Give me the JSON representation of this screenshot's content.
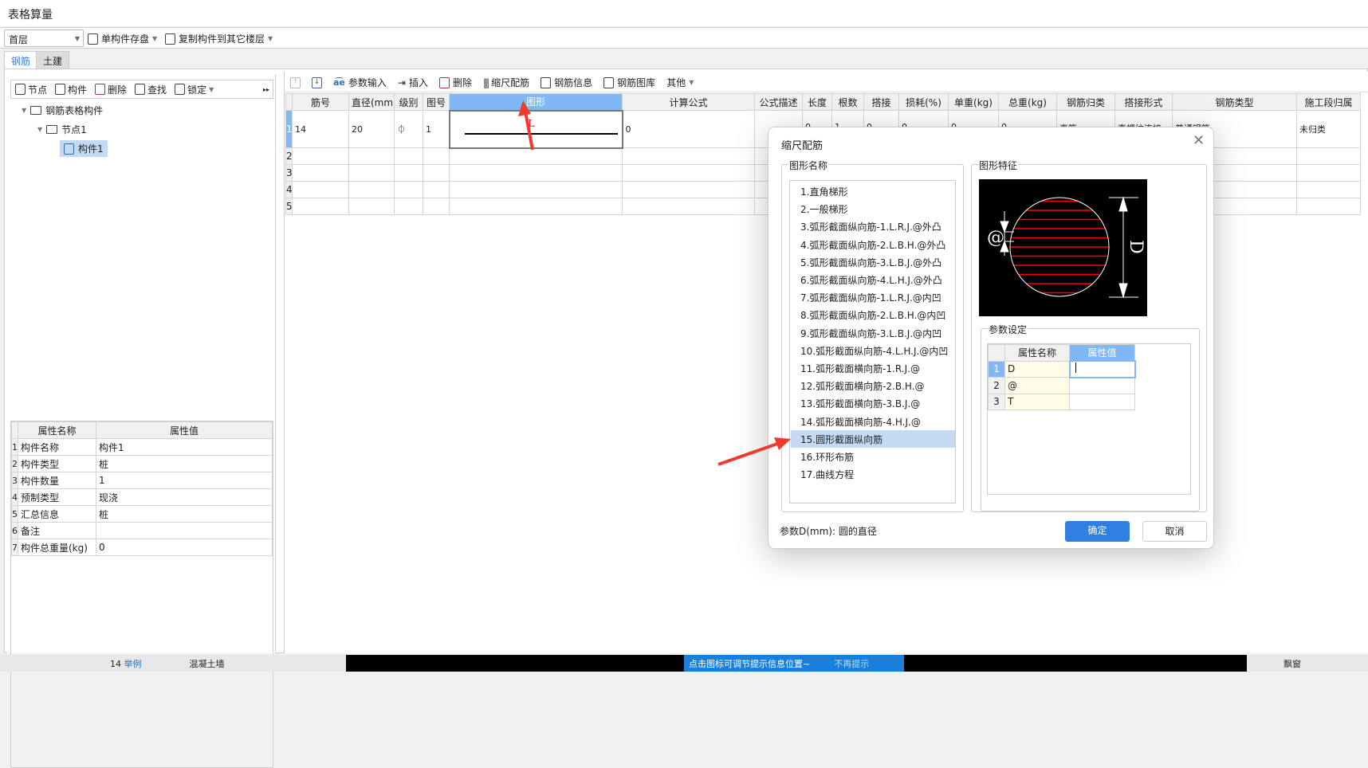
{
  "window": {
    "title": "表格算量"
  },
  "toolbar": {
    "floor": "首层",
    "save_single": "单构件存盘",
    "copy_to_floors": "复制构件到其它楼层"
  },
  "tabs": [
    {
      "label": "钢筋",
      "active": true
    },
    {
      "label": "土建",
      "active": false
    }
  ],
  "left_toolbar": {
    "node": "节点",
    "component": "构件",
    "delete": "删除",
    "find": "查找",
    "lock": "锁定"
  },
  "tree": {
    "root": "钢筋表格构件",
    "node": "节点1",
    "component": "构件1"
  },
  "props": {
    "headers": [
      "属性名称",
      "属性值"
    ],
    "rows": [
      {
        "n": "1",
        "name": "构件名称",
        "value": "构件1"
      },
      {
        "n": "2",
        "name": "构件类型",
        "value": "桩"
      },
      {
        "n": "3",
        "name": "构件数量",
        "value": "1"
      },
      {
        "n": "4",
        "name": "预制类型",
        "value": "现浇"
      },
      {
        "n": "5",
        "name": "汇总信息",
        "value": "桩"
      },
      {
        "n": "6",
        "name": "备注",
        "value": ""
      },
      {
        "n": "7",
        "name": "构件总重量(kg)",
        "value": "0"
      }
    ]
  },
  "right_toolbar": {
    "param_input": "参数输入",
    "insert": "插入",
    "delete": "删除",
    "scale_rebar": "缩尺配筋",
    "rebar_info": "钢筋信息",
    "rebar_library": "钢筋图库",
    "other": "其他"
  },
  "grid": {
    "headers": [
      "筋号",
      "直径(mm)",
      "级别",
      "图号",
      "图形",
      "计算公式",
      "公式描述",
      "长度",
      "根数",
      "搭接",
      "损耗(%)",
      "单重(kg)",
      "总重(kg)",
      "钢筋归类",
      "搭接形式",
      "钢筋类型",
      "施工段归属"
    ],
    "rows": [
      {
        "n": "1",
        "cells": [
          "14",
          "20",
          "⏀",
          "1",
          "L",
          "0",
          "",
          "0",
          "1",
          "0",
          "0",
          "0",
          "0",
          "直筋",
          "直螺纹连接",
          "普通钢筋",
          "未归类"
        ]
      },
      {
        "n": "2",
        "cells": [
          "",
          "",
          "",
          "",
          "",
          "",
          "",
          "",
          "",
          "",
          "",
          "",
          "",
          "",
          "",
          "",
          ""
        ]
      },
      {
        "n": "3",
        "cells": [
          "",
          "",
          "",
          "",
          "",
          "",
          "",
          "",
          "",
          "",
          "",
          "",
          "",
          "",
          "",
          "",
          ""
        ]
      },
      {
        "n": "4",
        "cells": [
          "",
          "",
          "",
          "",
          "",
          "",
          "",
          "",
          "",
          "",
          "",
          "",
          "",
          "",
          "",
          "",
          ""
        ]
      },
      {
        "n": "5",
        "cells": [
          "",
          "",
          "",
          "",
          "",
          "",
          "",
          "",
          "",
          "",
          "",
          "",
          "",
          "",
          "",
          "",
          ""
        ]
      }
    ]
  },
  "dialog": {
    "title": "缩尺配筋",
    "shape_group": "图形名称",
    "feature_group": "图形特征",
    "param_group": "参数设定",
    "shapes": [
      "1.直角梯形",
      "2.一般梯形",
      "3.弧形截面纵向筋-1.L.R.J.@外凸",
      "4.弧形截面纵向筋-2.L.B.H.@外凸",
      "5.弧形截面纵向筋-3.L.B.J.@外凸",
      "6.弧形截面纵向筋-4.L.H.J.@外凸",
      "7.弧形截面纵向筋-1.L.R.J.@内凹",
      "8.弧形截面纵向筋-2.L.B.H.@内凹",
      "9.弧形截面纵向筋-3.L.B.J.@内凹",
      "10.弧形截面纵向筋-4.L.H.J.@内凹",
      "11.弧形截面横向筋-1.R.J.@",
      "12.弧形截面横向筋-2.B.H.@",
      "13.弧形截面横向筋-3.B.J.@",
      "14.弧形截面横向筋-4.H.J.@",
      "15.圆形截面纵向筋",
      "16.环形布筋",
      "17.曲线方程"
    ],
    "selected_shape": "15.圆形截面纵向筋",
    "figure_labels": {
      "spacing": "@",
      "diameter": "D"
    },
    "param_headers": [
      "属性名称",
      "属性值"
    ],
    "params": [
      {
        "n": "1",
        "name": "D",
        "value": ""
      },
      {
        "n": "2",
        "name": "@",
        "value": ""
      },
      {
        "n": "3",
        "name": "T",
        "value": ""
      }
    ],
    "hint": "参数D(mm): 圆的直径",
    "ok": "确定",
    "cancel": "取消"
  },
  "bottom": {
    "hint": "点击图标可调节提示信息位置~",
    "dismiss": "不再提示",
    "item_no": "14",
    "item_a": "举例",
    "item_b": "混凝土墙",
    "right_item": "飘窗"
  },
  "colors": {
    "accent": "#2f7fe0",
    "header_selected": "#7fb8f5",
    "selected_item": "#c3daf2",
    "annotation_arrow": "#f03a2e"
  }
}
